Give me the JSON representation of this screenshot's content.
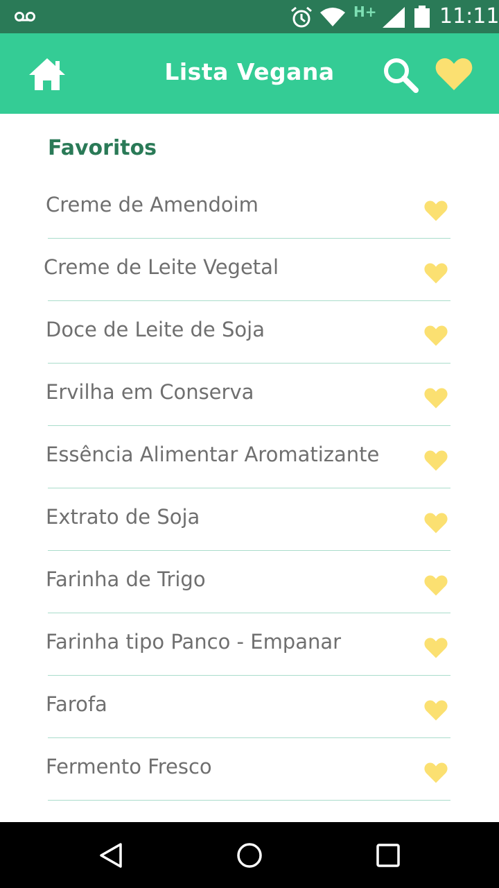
{
  "status_bar": {
    "time": "11:11",
    "network_type": "H+",
    "icons": [
      "voicemail-icon",
      "alarm-icon",
      "wifi-icon",
      "signal-icon",
      "battery-icon"
    ]
  },
  "app_bar": {
    "title": "Lista Vegana",
    "home_icon": "home-icon",
    "search_icon": "search-icon",
    "favorites_icon": "heart-icon"
  },
  "section": {
    "title": "Favoritos"
  },
  "favorites": [
    {
      "label": "Creme de Amendoim"
    },
    {
      "label": "Creme de Leite Vegetal"
    },
    {
      "label": "Doce de Leite de Soja"
    },
    {
      "label": "Ervilha em Conserva"
    },
    {
      "label": "Essência Alimentar Aromatizante"
    },
    {
      "label": "Extrato de Soja"
    },
    {
      "label": "Farinha de Trigo"
    },
    {
      "label": "Farinha tipo Panco - Empanar"
    },
    {
      "label": "Farofa"
    },
    {
      "label": "Fermento Fresco"
    }
  ],
  "nav_bar": {
    "icons": [
      "back-icon",
      "home-circle-icon",
      "recents-icon"
    ]
  },
  "colors": {
    "status_bar": "#2a7a57",
    "app_bar": "#34cc95",
    "section_title": "#2a7a57",
    "heart": "#fbe071",
    "item_text": "#6f6f6f",
    "divider": "#a9dccb"
  }
}
